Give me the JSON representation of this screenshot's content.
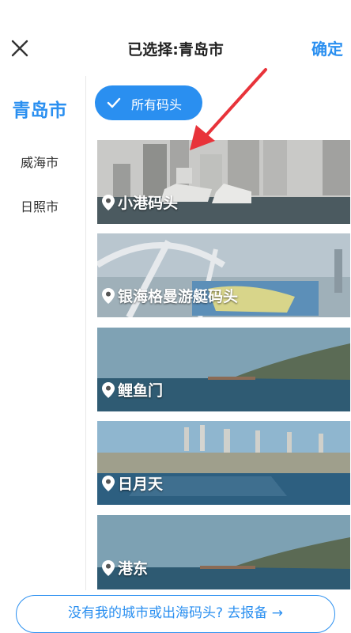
{
  "header": {
    "title": "已选择:青岛市",
    "confirm_label": "确定"
  },
  "sidebar": {
    "cities": [
      {
        "label": "青岛市",
        "active": true
      },
      {
        "label": "威海市",
        "active": false
      },
      {
        "label": "日照市",
        "active": false
      }
    ]
  },
  "filter": {
    "label": "所有码头",
    "selected": true
  },
  "docks": [
    {
      "name": "小港码头"
    },
    {
      "name": "银海格曼游艇码头"
    },
    {
      "name": "鲤鱼门"
    },
    {
      "name": "日月天"
    },
    {
      "name": "港东"
    }
  ],
  "footer": {
    "report_label": "没有我的城市或出海码头? 去报备"
  },
  "colors": {
    "accent": "#2a8ff0",
    "annotation_arrow": "#e8333a"
  }
}
